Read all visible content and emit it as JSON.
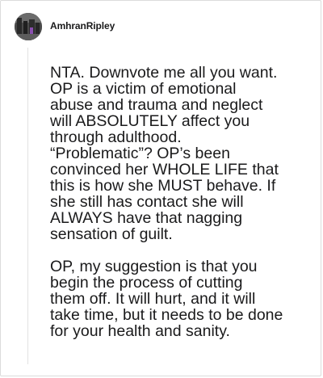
{
  "post": {
    "username": "AmhranRipley",
    "paragraphs": [
      "NTA. Downvote me all you want.\nOP is a victim of emotional\nabuse and trauma and neglect\nwill ABSOLUTELY affect you\nthrough adulthood.\n“Problematic”? OP’s been\nconvinced her WHOLE LIFE that\nthis is how she MUST behave. If\nshe still has contact she will\nALWAYS have that nagging\nsensation of guilt.",
      "OP, my suggestion is that you\nbegin the process of cutting\nthem off. It will hurt, and it will\ntake time, but it needs to be done\nfor your health and sanity."
    ]
  }
}
